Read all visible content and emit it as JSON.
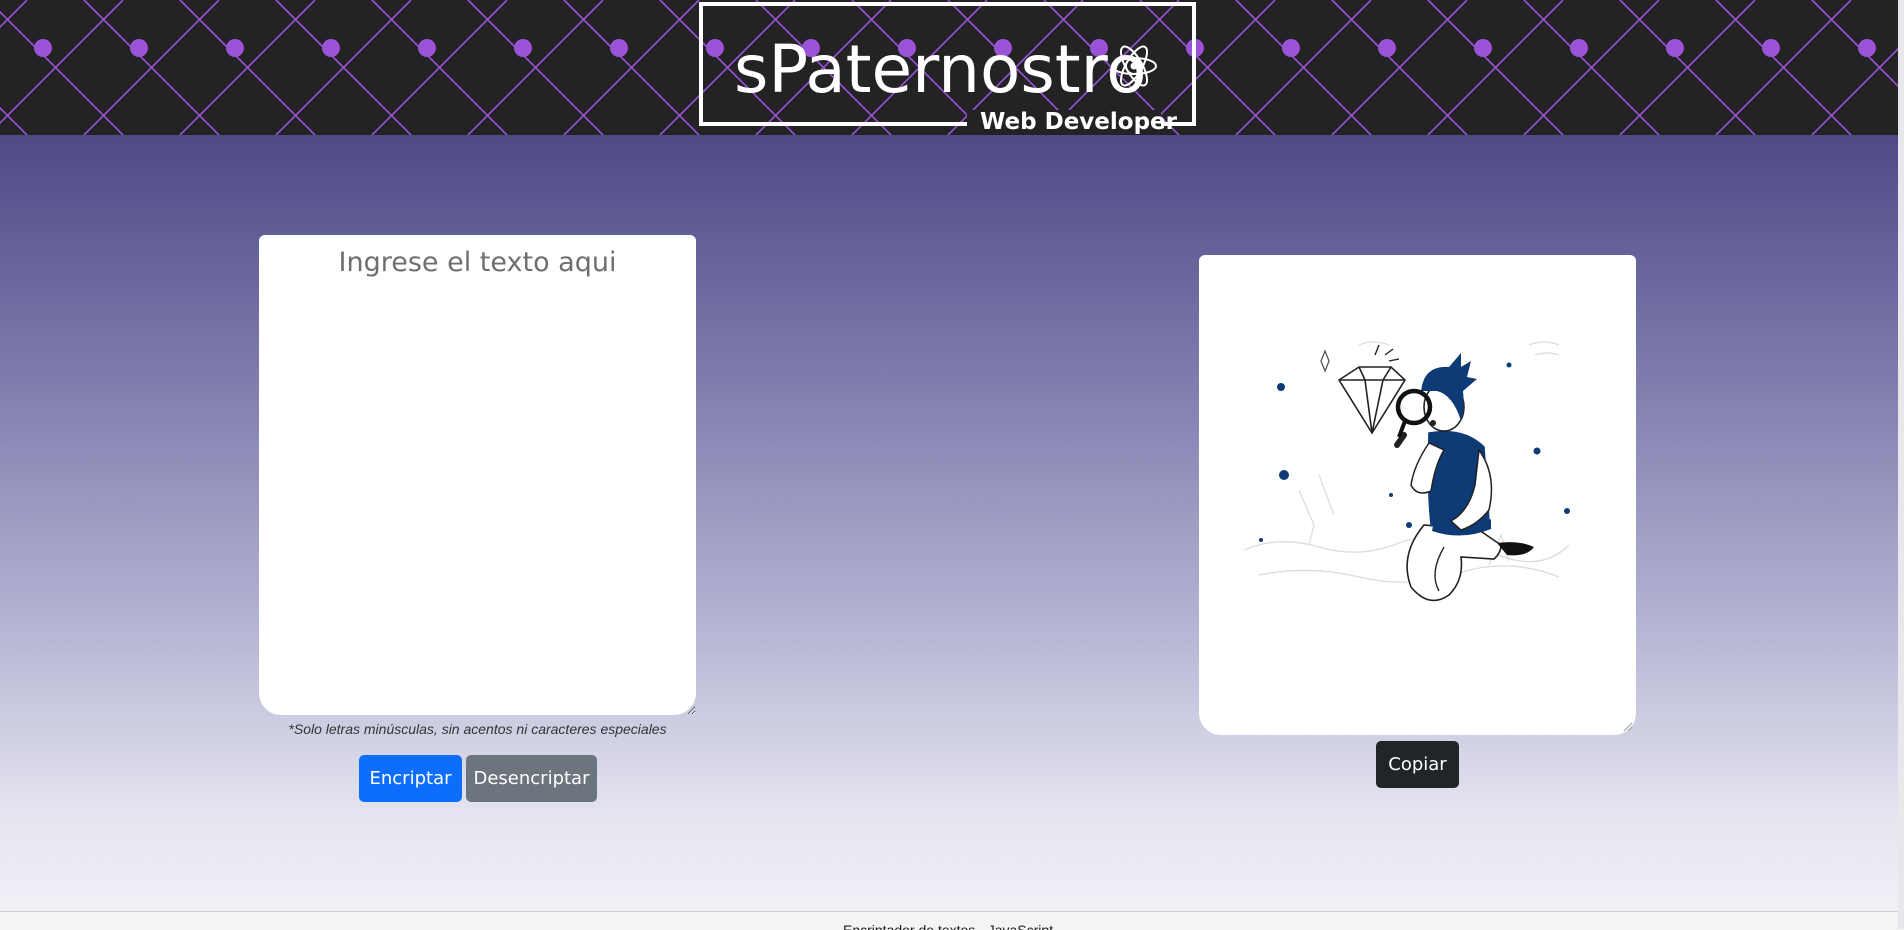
{
  "header": {
    "brand_name": "sPaternostro",
    "brand_subtitle": "Web Developer",
    "brand_icon": "atom-icon"
  },
  "encryptor": {
    "input_placeholder": "Ingrese el texto aqui",
    "input_value": "",
    "hint": "*Solo letras minúsculas, sin acentos ni caracteres especiales",
    "encrypt_label": "Encriptar",
    "decrypt_label": "Desencriptar"
  },
  "output": {
    "illustration": "person-with-magnifying-glass-and-diamond",
    "copy_label": "Copiar"
  },
  "footer": {
    "text": "Encriptador de textos · JavaScript"
  },
  "colors": {
    "header_bg": "#232325",
    "pattern_line": "#9a53d6",
    "encrypt_button": "#0d6efd",
    "decrypt_button": "#6c757d",
    "copy_button": "#212529",
    "illustration_accent": "#0e3a75"
  }
}
